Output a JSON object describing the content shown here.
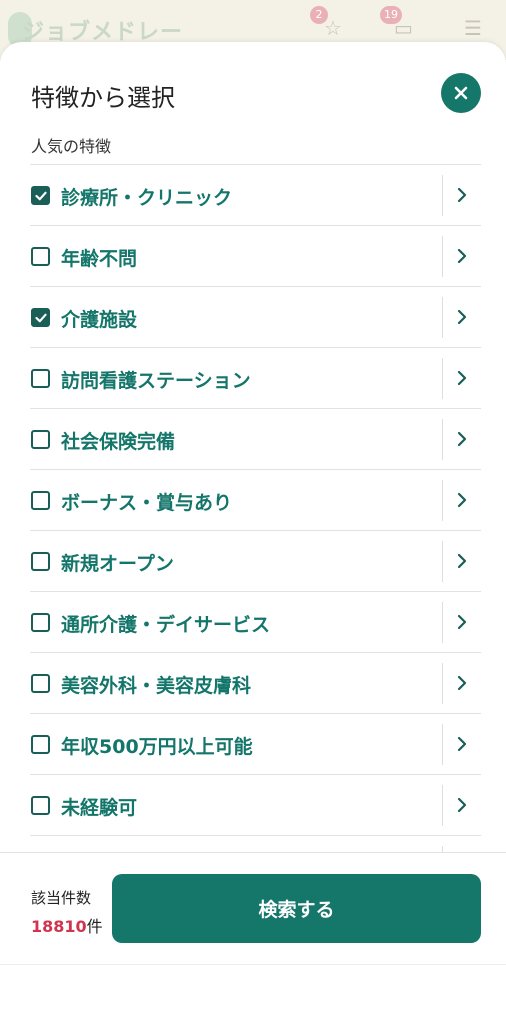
{
  "background_header": {
    "logo_text": "ジョブメドレー",
    "icons": [
      {
        "name": "star-icon",
        "badge": "2"
      },
      {
        "name": "chat-icon",
        "badge": "19"
      },
      {
        "name": "menu-icon",
        "badge": ""
      }
    ]
  },
  "modal": {
    "title": "特徴から選択",
    "section_label": "人気の特徴",
    "items": [
      {
        "label": "診療所・クリニック",
        "checked": true
      },
      {
        "label": "年齢不問",
        "checked": false
      },
      {
        "label": "介護施設",
        "checked": true
      },
      {
        "label": "訪問看護ステーション",
        "checked": false
      },
      {
        "label": "社会保険完備",
        "checked": false
      },
      {
        "label": "ボーナス・賞与あり",
        "checked": false
      },
      {
        "label": "新規オープン",
        "checked": false
      },
      {
        "label": "通所介護・デイサービス",
        "checked": false
      },
      {
        "label": "美容外科・美容皮膚科",
        "checked": false
      },
      {
        "label": "年収500万円以上可能",
        "checked": false
      },
      {
        "label": "未経験可",
        "checked": false
      }
    ]
  },
  "footer": {
    "count_label": "該当件数",
    "count_value": "18810",
    "count_unit": "件",
    "search_button": "検索する"
  },
  "colors": {
    "accent": "#15766a",
    "count": "#d0344e"
  }
}
